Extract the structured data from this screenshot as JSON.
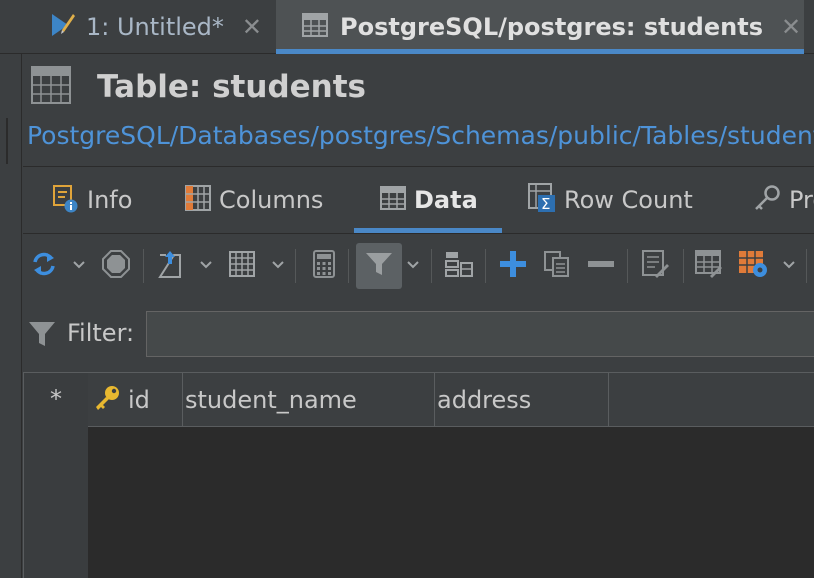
{
  "editor_tabs": [
    {
      "label": "1: Untitled*",
      "icon": "pencil-script-icon"
    },
    {
      "label": "PostgreSQL/postgres: students",
      "icon": "table-icon",
      "active": true
    }
  ],
  "header": {
    "title": "Table: students",
    "breadcrumb": "PostgreSQL/Databases/postgres/Schemas/public/Tables/students"
  },
  "inner_tabs": [
    {
      "label": "Info",
      "icon": "info-icon"
    },
    {
      "label": "Columns",
      "icon": "columns-icon"
    },
    {
      "label": "Data",
      "icon": "table-icon",
      "active": true
    },
    {
      "label": "Row Count",
      "icon": "row-count-icon"
    },
    {
      "label": "Properties",
      "icon": "key-icon"
    }
  ],
  "toolbar": {
    "icons": [
      "refresh-icon",
      "stop-icon",
      "export-icon",
      "grid-view-icon",
      "calculator-icon",
      "filter-icon",
      "sort-icon",
      "add-row-icon",
      "duplicate-row-icon",
      "delete-row-icon",
      "edit-cell-icon",
      "edit-grid-icon",
      "grid-settings-icon"
    ]
  },
  "filter": {
    "label": "Filter:",
    "value": ""
  },
  "grid": {
    "row_marker": "*",
    "columns": [
      {
        "name": "id",
        "primary_key": true
      },
      {
        "name": "student_name"
      },
      {
        "name": "address"
      }
    ]
  },
  "colors": {
    "accent": "#4a88c7",
    "link": "#4e93d8",
    "background": "#3c3f41",
    "grid_background": "#2b2b2b",
    "key_icon": "#e8b830"
  }
}
